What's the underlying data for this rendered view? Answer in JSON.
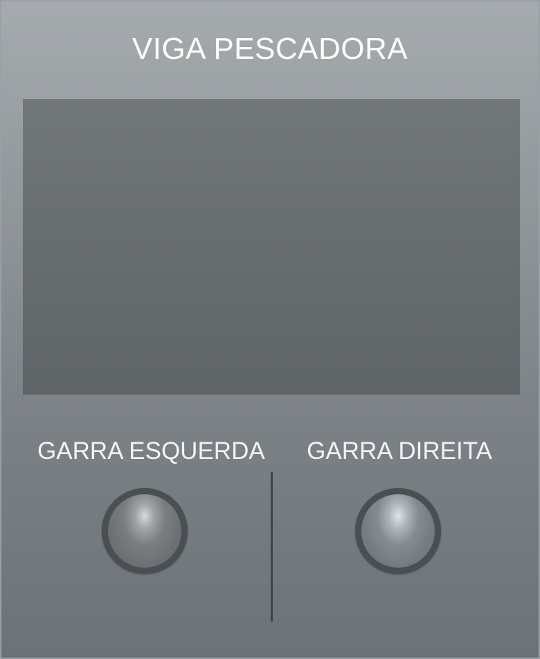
{
  "panel": {
    "title": "VIGA PESCADORA"
  },
  "indicators": [
    {
      "label": "GARRA ESQUERDA",
      "state": "off",
      "color": "#6c7072"
    },
    {
      "label": "GARRA DIREITA",
      "state": "off",
      "color": "#747b7e"
    }
  ],
  "colors": {
    "panel_background": "#8f9497",
    "screen_background": "#686d6e",
    "label_text": "#f2f3f3"
  }
}
